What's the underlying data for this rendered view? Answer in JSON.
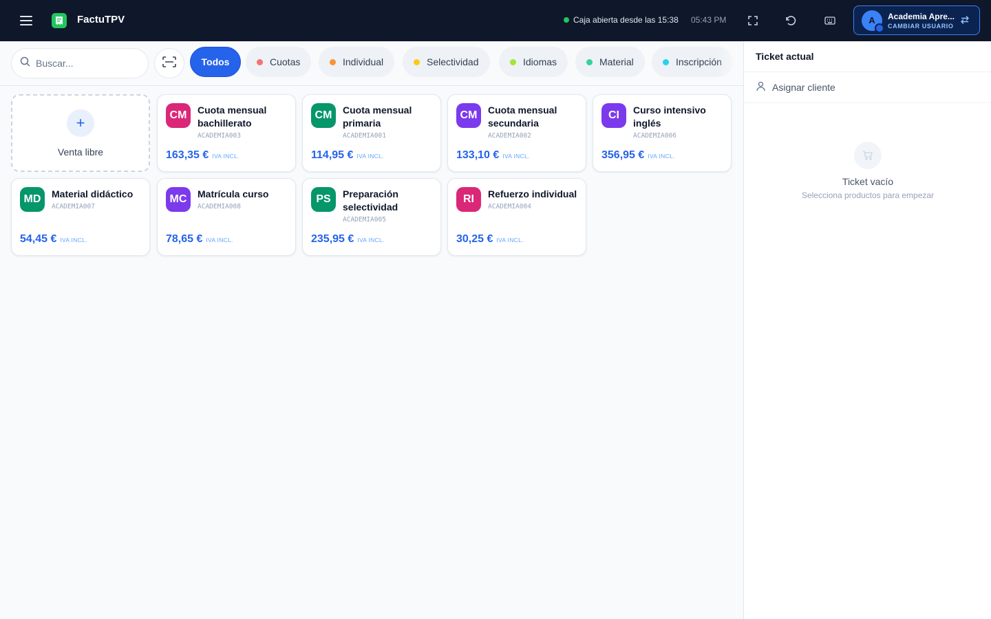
{
  "header": {
    "app_title": "FactuTPV",
    "status_text": "Caja abierta desde las 15:38",
    "time": "05:43 PM",
    "user": {
      "avatar_initial": "A",
      "name": "Academia Apre...",
      "switch_label": "CAMBIAR USUARIO"
    }
  },
  "search": {
    "placeholder": "Buscar..."
  },
  "categories": [
    {
      "label": "Todos",
      "active": true
    },
    {
      "label": "Cuotas",
      "color": "#f87171"
    },
    {
      "label": "Individual",
      "color": "#fb923c"
    },
    {
      "label": "Selectividad",
      "color": "#facc15"
    },
    {
      "label": "Idiomas",
      "color": "#a3e635"
    },
    {
      "label": "Material",
      "color": "#34d399"
    },
    {
      "label": "Inscripción",
      "color": "#22d3ee"
    }
  ],
  "free_sale": {
    "label": "Venta libre"
  },
  "products": [
    {
      "initials": "CM",
      "name": "Cuota mensual bachillerato",
      "code": "ACADEMIA003",
      "price": "163,35 €",
      "tax": "IVA INCL.",
      "color": "#db2777"
    },
    {
      "initials": "CM",
      "name": "Cuota mensual primaria",
      "code": "ACADEMIA001",
      "price": "114,95 €",
      "tax": "IVA INCL.",
      "color": "#059669"
    },
    {
      "initials": "CM",
      "name": "Cuota mensual secundaria",
      "code": "ACADEMIA002",
      "price": "133,10 €",
      "tax": "IVA INCL.",
      "color": "#7c3aed"
    },
    {
      "initials": "CI",
      "name": "Curso intensivo inglés",
      "code": "ACADEMIA006",
      "price": "356,95 €",
      "tax": "IVA INCL.",
      "color": "#7c3aed"
    },
    {
      "initials": "MD",
      "name": "Material didáctico",
      "code": "ACADEMIA007",
      "price": "54,45 €",
      "tax": "IVA INCL.",
      "color": "#059669"
    },
    {
      "initials": "MC",
      "name": "Matrícula curso",
      "code": "ACADEMIA008",
      "price": "78,65 €",
      "tax": "IVA INCL.",
      "color": "#7c3aed"
    },
    {
      "initials": "PS",
      "name": "Preparación selectividad",
      "code": "ACADEMIA005",
      "price": "235,95 €",
      "tax": "IVA INCL.",
      "color": "#059669"
    },
    {
      "initials": "RI",
      "name": "Refuerzo individual",
      "code": "ACADEMIA004",
      "price": "30,25 €",
      "tax": "IVA INCL.",
      "color": "#db2777"
    }
  ],
  "ticket": {
    "title": "Ticket actual",
    "assign_client": "Asignar cliente",
    "empty_title": "Ticket vacío",
    "empty_sub": "Selecciona productos para empezar"
  },
  "icons": {
    "menu": "hamburger-icon",
    "logo": "receipt-logo-icon",
    "fullscreen": "fullscreen-icon",
    "refresh": "refresh-icon",
    "keyboard": "keyboard-icon",
    "swap": "swap-arrows-icon",
    "search": "search-icon",
    "scan": "barcode-scan-icon",
    "user": "user-icon",
    "cart": "cart-icon"
  },
  "colors": {
    "topbar": "#0f172a",
    "accent": "#2563eb",
    "status_ok": "#22c55e"
  }
}
